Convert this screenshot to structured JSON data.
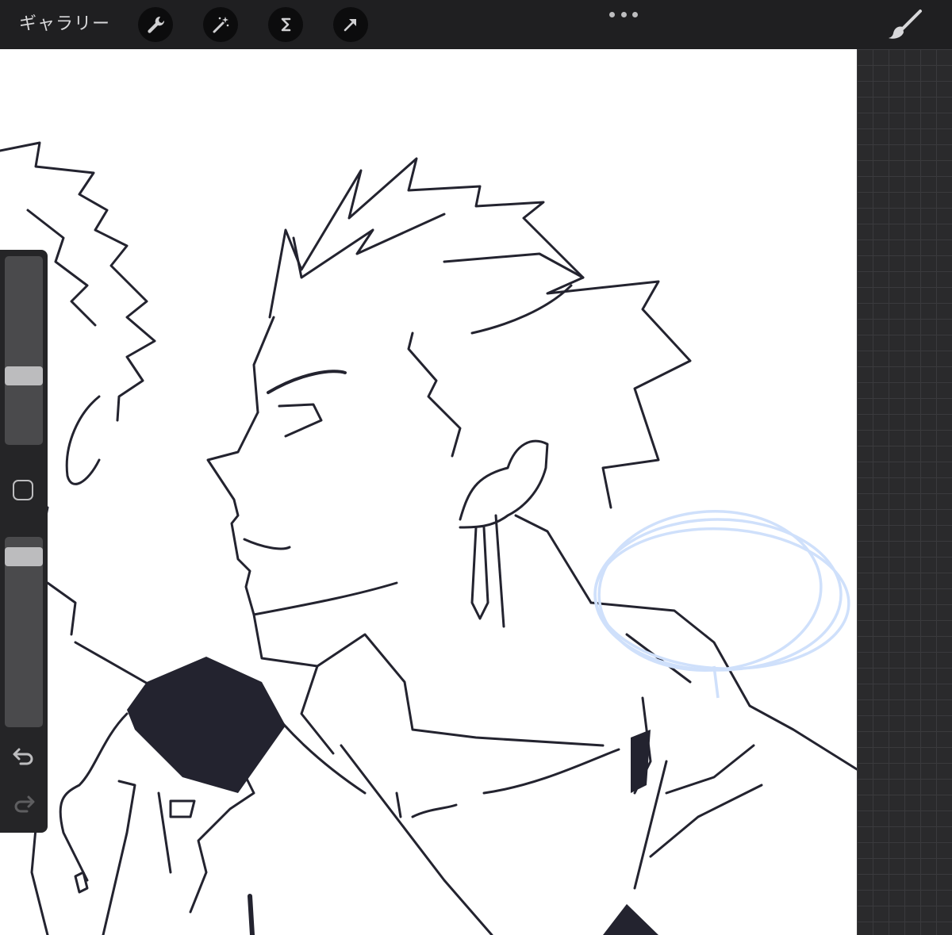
{
  "toolbar": {
    "gallery_label": "ギャラリー",
    "tools": [
      {
        "name": "actions",
        "icon": "wrench-icon"
      },
      {
        "name": "adjustments",
        "icon": "magic-wand-icon"
      },
      {
        "name": "selection",
        "icon": "selection-s-icon"
      },
      {
        "name": "transform",
        "icon": "arrow-cursor-icon"
      }
    ],
    "more_icon": "ellipsis-icon",
    "brush_icon": "brush-icon"
  },
  "sidebar": {
    "brush_size_level": 0.35,
    "opacity_level": 0.94,
    "modify_icon": "square-modify-icon",
    "undo_icon": "undo-icon",
    "redo_icon": "redo-icon"
  },
  "colors": {
    "toolbar_bg": "#1f1f21",
    "canvas_bg": "#ffffff",
    "ink": "#23232f",
    "sketch_blue": "#cfe0fb",
    "panel_bg": "#252527"
  }
}
